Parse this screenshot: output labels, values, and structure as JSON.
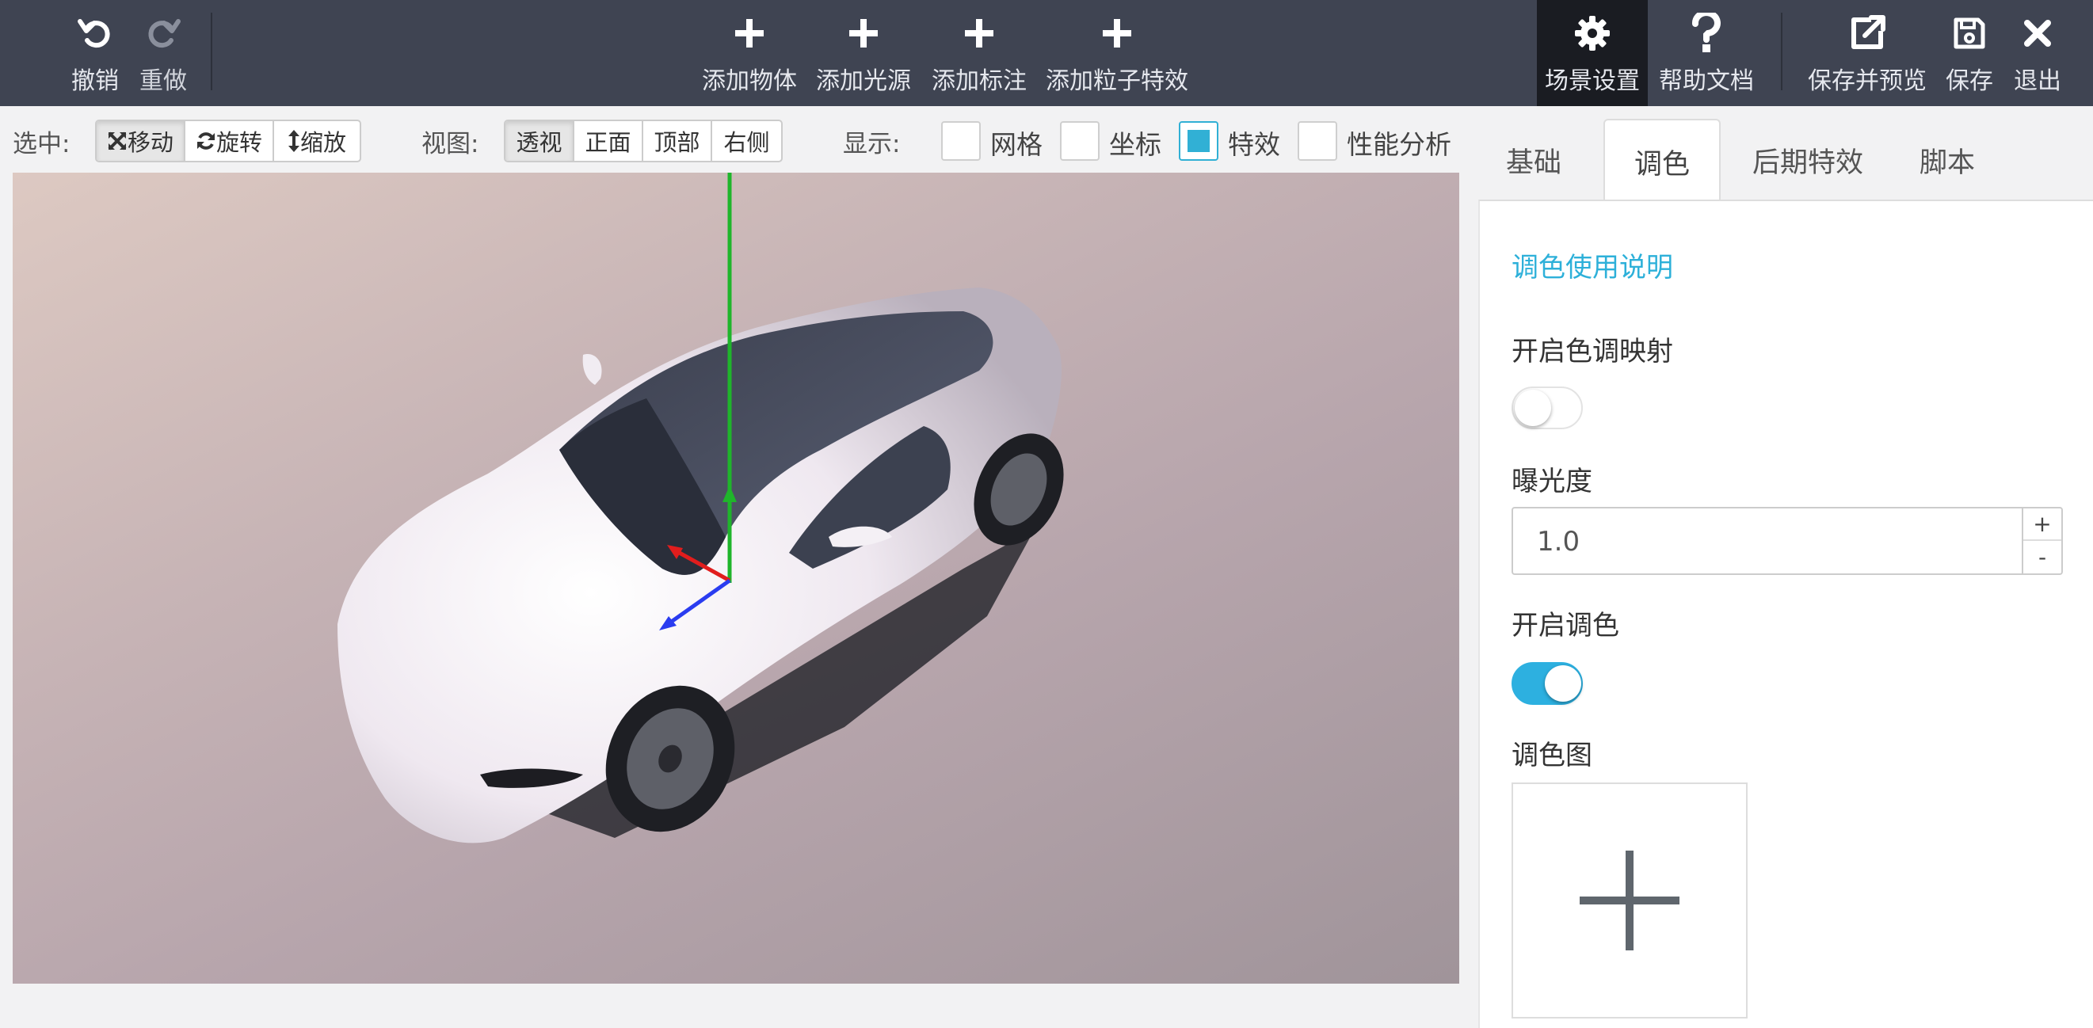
{
  "topbar": {
    "undo_label": "撤销",
    "redo_label": "重做",
    "add_object_label": "添加物体",
    "add_light_label": "添加光源",
    "add_annotation_label": "添加标注",
    "add_particle_label": "添加粒子特效",
    "scene_settings_label": "场景设置",
    "help_label": "帮助文档",
    "save_preview_label": "保存并预览",
    "save_label": "保存",
    "exit_label": "退出"
  },
  "toolbar": {
    "select_label": "选中:",
    "transform": [
      "移动",
      "旋转",
      "缩放"
    ],
    "view_label": "视图:",
    "views": [
      "透视",
      "正面",
      "顶部",
      "右侧"
    ],
    "display_label": "显示:",
    "display_options": [
      {
        "label": "网格",
        "checked": false
      },
      {
        "label": "坐标",
        "checked": false
      },
      {
        "label": "特效",
        "checked": true
      },
      {
        "label": "性能分析",
        "checked": false
      }
    ]
  },
  "panel": {
    "tabs": [
      "基础",
      "调色",
      "后期特效",
      "脚本"
    ],
    "active_tab": "调色",
    "help_link": "调色使用说明",
    "tone_mapping_label": "开启色调映射",
    "tone_mapping_on": false,
    "exposure_label": "曝光度",
    "exposure_value": "1.0",
    "step_up": "+",
    "step_down": "-",
    "color_grading_label": "开启调色",
    "color_grading_on": true,
    "lut_label": "调色图"
  },
  "colors": {
    "topbar_bg": "#3f4452",
    "accent": "#2db0e0"
  }
}
